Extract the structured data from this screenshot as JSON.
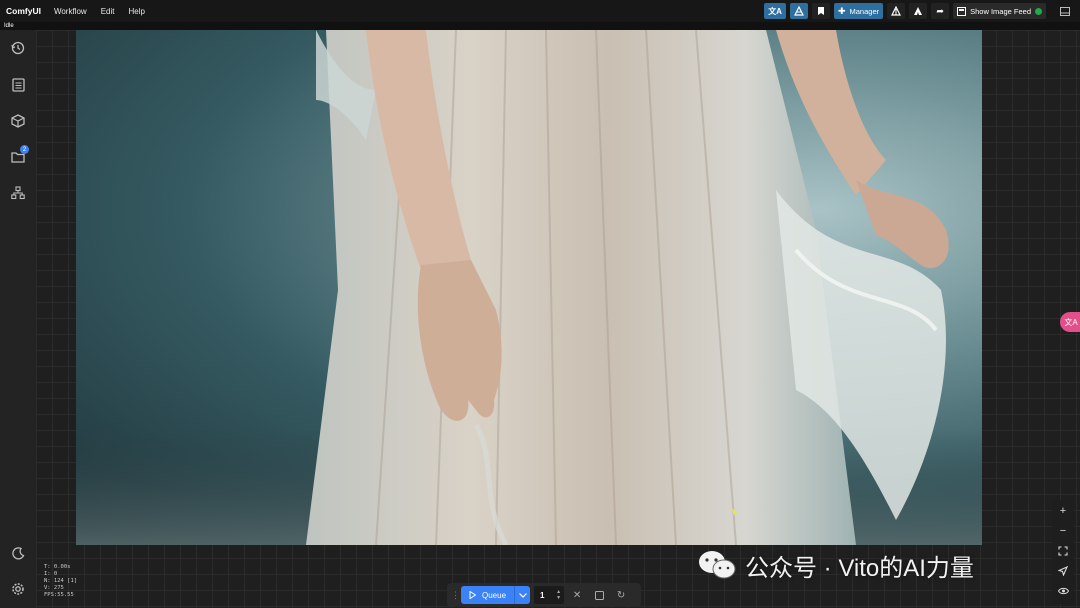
{
  "app": {
    "title": "ComfyUI"
  },
  "menu": {
    "items": [
      "Workflow",
      "Edit",
      "Help"
    ]
  },
  "toolbar": {
    "manager_label": "Manager",
    "image_feed_label": "Show Image Feed",
    "icons": [
      "translate-icon",
      "mask-icon",
      "bookmark-icon",
      "puzzle-icon",
      "model-icon",
      "model-alt-icon",
      "share-icon",
      "image-feed-icon",
      "panel-toggle-icon"
    ],
    "accent": "#2f6f9f"
  },
  "status": {
    "text": "Idle"
  },
  "sidebar": {
    "items": [
      {
        "name": "history-icon"
      },
      {
        "name": "queue-icon"
      },
      {
        "name": "model-library-icon"
      },
      {
        "name": "workflows-icon",
        "badge": "2"
      },
      {
        "name": "node-library-icon"
      }
    ],
    "bottom": [
      "theme-toggle-icon",
      "settings-icon"
    ]
  },
  "stats": {
    "lines": [
      "T: 0.00s",
      "I: 0",
      "N: 124 [1]",
      "V: 275",
      "FPS:55.55"
    ]
  },
  "queue": {
    "label": "Queue",
    "count": "1"
  },
  "zoom_controls": [
    "zoom-in",
    "zoom-out",
    "fit-view",
    "locate",
    "toggle-visibility"
  ],
  "translate_badge": "文A",
  "watermark": {
    "text": "公众号 · Vito的AI力量"
  },
  "colors": {
    "queue_blue": "#3b82f6",
    "badge_pink": "#e24f8a",
    "background": "#202020"
  }
}
